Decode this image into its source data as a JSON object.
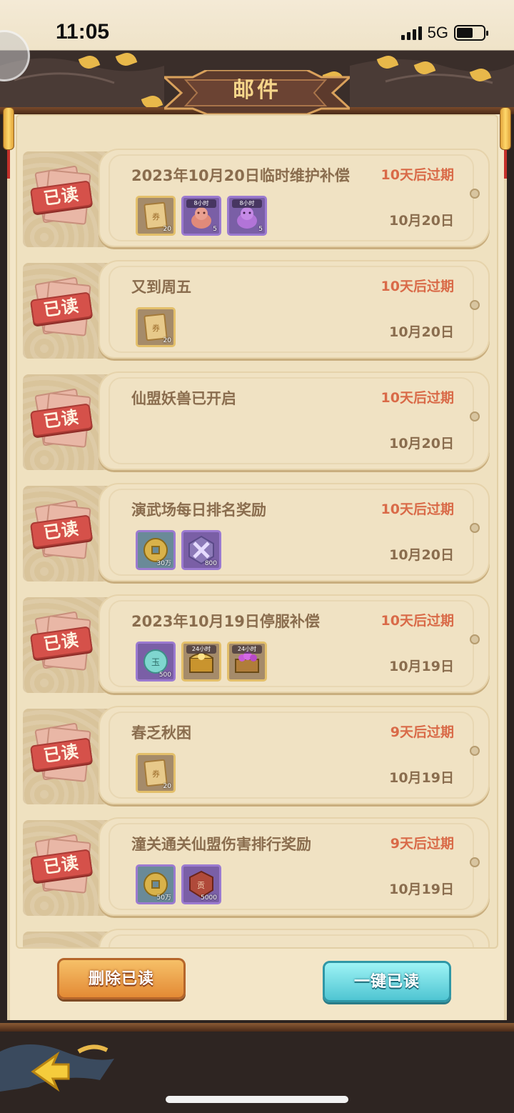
{
  "status_bar": {
    "time": "11:05",
    "network": "5G"
  },
  "header": {
    "title": "邮件"
  },
  "mails": [
    {
      "title": "2023年10月20日临时维护补偿",
      "expire": "10天后过期",
      "date": "10月20日",
      "status": "已读",
      "rewards": [
        {
          "icon": "ticket-icon",
          "quantity": "20",
          "tag": "",
          "rarity": "gold"
        },
        {
          "icon": "pink-pig-icon",
          "quantity": "5",
          "tag": "8小时",
          "rarity": "purple"
        },
        {
          "icon": "purple-pig-icon",
          "quantity": "5",
          "tag": "8小时",
          "rarity": "purple"
        }
      ]
    },
    {
      "title": "又到周五",
      "expire": "10天后过期",
      "date": "10月20日",
      "status": "已读",
      "rewards": [
        {
          "icon": "ticket-icon",
          "quantity": "20",
          "tag": "",
          "rarity": "gold"
        }
      ]
    },
    {
      "title": "仙盟妖兽已开启",
      "expire": "10天后过期",
      "date": "10月20日",
      "status": "已读",
      "rewards": []
    },
    {
      "title": "演武场每日排名奖励",
      "expire": "10天后过期",
      "date": "10月20日",
      "status": "已读",
      "rewards": [
        {
          "icon": "copper-coin-icon",
          "quantity": "30万",
          "tag": "",
          "rarity": "cyan"
        },
        {
          "icon": "crossed-swords-icon",
          "quantity": "800",
          "tag": "",
          "rarity": "purple"
        }
      ]
    },
    {
      "title": "2023年10月19日停服补偿",
      "expire": "10天后过期",
      "date": "10月19日",
      "status": "已读",
      "rewards": [
        {
          "icon": "jade-coin-icon",
          "quantity": "500",
          "tag": "",
          "rarity": "purple"
        },
        {
          "icon": "gold-chest-icon",
          "quantity": "",
          "tag": "24小时",
          "rarity": "gold"
        },
        {
          "icon": "purple-chest-icon",
          "quantity": "",
          "tag": "24小时",
          "rarity": "gold"
        }
      ]
    },
    {
      "title": "春乏秋困",
      "expire": "9天后过期",
      "date": "10月19日",
      "status": "已读",
      "rewards": [
        {
          "icon": "ticket-icon",
          "quantity": "20",
          "tag": "",
          "rarity": "gold"
        }
      ]
    },
    {
      "title": "潼关通关仙盟伤害排行奖励",
      "expire": "9天后过期",
      "date": "10月19日",
      "status": "已读",
      "rewards": [
        {
          "icon": "copper-coin-icon",
          "quantity": "50万",
          "tag": "",
          "rarity": "cyan"
        },
        {
          "icon": "badge-icon",
          "quantity": "5000",
          "tag": "",
          "rarity": "purple"
        }
      ]
    }
  ],
  "buttons": {
    "delete_read": "删除已读",
    "read_all": "一键已读"
  },
  "colors": {
    "expire_text": "#d96a48",
    "title_text": "#8a6d4e",
    "stamp_red": "#d5514a",
    "delete_button": "#e38a35",
    "read_all_button": "#4fc5d2"
  }
}
